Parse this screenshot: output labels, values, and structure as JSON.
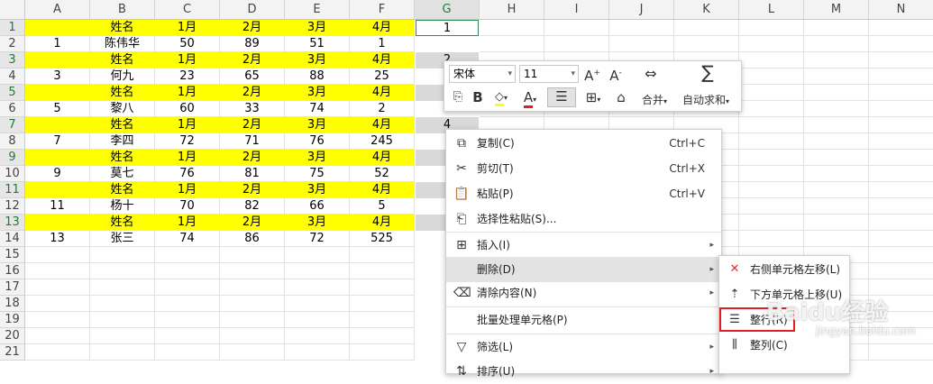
{
  "columns": [
    "A",
    "B",
    "C",
    "D",
    "E",
    "F",
    "G",
    "H",
    "I",
    "J",
    "K",
    "L",
    "M",
    "N"
  ],
  "rows": [
    "1",
    "2",
    "3",
    "4",
    "5",
    "6",
    "7",
    "8",
    "9",
    "10",
    "11",
    "12",
    "13",
    "14",
    "15",
    "16",
    "17",
    "18",
    "19",
    "20",
    "21"
  ],
  "cells": [
    [
      "",
      "姓名",
      "1月",
      "2月",
      "3月",
      "4月"
    ],
    [
      "1",
      "陈伟华",
      "50",
      "89",
      "51",
      "1"
    ],
    [
      "",
      "姓名",
      "1月",
      "2月",
      "3月",
      "4月"
    ],
    [
      "3",
      "何九",
      "23",
      "65",
      "88",
      "25"
    ],
    [
      "",
      "姓名",
      "1月",
      "2月",
      "3月",
      "4月"
    ],
    [
      "5",
      "黎八",
      "60",
      "33",
      "74",
      "2"
    ],
    [
      "",
      "姓名",
      "1月",
      "2月",
      "3月",
      "4月"
    ],
    [
      "7",
      "李四",
      "72",
      "71",
      "76",
      "245"
    ],
    [
      "",
      "姓名",
      "1月",
      "2月",
      "3月",
      "4月"
    ],
    [
      "9",
      "莫七",
      "76",
      "81",
      "75",
      "52"
    ],
    [
      "",
      "姓名",
      "1月",
      "2月",
      "3月",
      "4月"
    ],
    [
      "11",
      "杨十",
      "70",
      "82",
      "66",
      "5"
    ],
    [
      "",
      "姓名",
      "1月",
      "2月",
      "3月",
      "4月"
    ],
    [
      "13",
      "张三",
      "74",
      "86",
      "72",
      "525"
    ]
  ],
  "g_values": {
    "r1": "1",
    "r3": "2",
    "r7": "4"
  },
  "minibar": {
    "font_name": "宋体",
    "font_size": "11",
    "merge_label": "合并",
    "autosum_label": "自动求和"
  },
  "context_menu": {
    "copy": {
      "label": "复制(C)",
      "shortcut": "Ctrl+C"
    },
    "cut": {
      "label": "剪切(T)",
      "shortcut": "Ctrl+X"
    },
    "paste": {
      "label": "粘贴(P)",
      "shortcut": "Ctrl+V"
    },
    "paste_special": {
      "label": "选择性粘贴(S)..."
    },
    "insert": {
      "label": "插入(I)"
    },
    "delete": {
      "label": "删除(D)"
    },
    "clear": {
      "label": "清除内容(N)"
    },
    "batch": {
      "label": "批量处理单元格(P)"
    },
    "filter": {
      "label": "筛选(L)"
    },
    "sort": {
      "label": "排序(U)"
    }
  },
  "submenu": {
    "shift_left": "右侧单元格左移(L)",
    "shift_up": "下方单元格上移(U)",
    "entire_row": "整行(R)",
    "entire_col": "整列(C)"
  },
  "watermark": {
    "text": "Baidu经验",
    "sub": "jingyan.baidu.com"
  },
  "colors": {
    "highlight": "#ffff00",
    "accent_green": "#1f7a3a",
    "red_box": "#e02020"
  }
}
